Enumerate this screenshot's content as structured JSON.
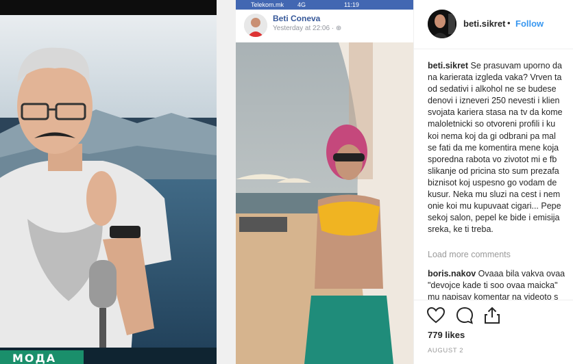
{
  "media": {
    "tv_badge": "МОДА",
    "phone": {
      "status_carrier": "Telekom.mk",
      "status_network": "4G",
      "status_time": "11:19",
      "post_author": "Beti Coneva",
      "post_time": "Yesterday at 22:06 · ⊕"
    }
  },
  "sidebar": {
    "username": "beti.sikret",
    "separator": "•",
    "follow_label": "Follow",
    "caption_user": "beti.sikret",
    "caption_lines": [
      " Se prasuvam uporno da",
      "na karierata izgleda vaka? Vrven ta",
      "od sedativi i alkohol ne se budese",
      "denovi i izneveri 250 nevesti i klien",
      "svojata kariera stasa na tv da kome",
      "maloletnicki so otvoreni profili i ku",
      "koi nema koj da gi odbrani pa mal",
      "se fati da me komentira mene koja",
      "sporedna rabota vo zivotot mi e fb",
      "slikanje od pricina sto sum prezafa",
      "biznisot koj uspesno go vodam de",
      "kusur. Neka mu sluzi na cest i nem",
      "onie koi mu kupuvaat cigari... Pepe",
      "sekoj salon, pepel ke bide i emisija",
      "sreka, ke ti treba."
    ],
    "load_more": "Load more comments",
    "comment_user": "boris.nakov",
    "comment_lines": [
      " Ovaaa bila vakva ovaa",
      "\"devojce kade ti soo ovaa maicka\"",
      "mu napisav komentar na videoto s"
    ],
    "likes": "779 likes",
    "date": "AUGUST 2"
  },
  "colors": {
    "accent_blue": "#3897f0",
    "facebook_blue": "#4267b2",
    "tv_badge_green": "#1a8f6b"
  }
}
